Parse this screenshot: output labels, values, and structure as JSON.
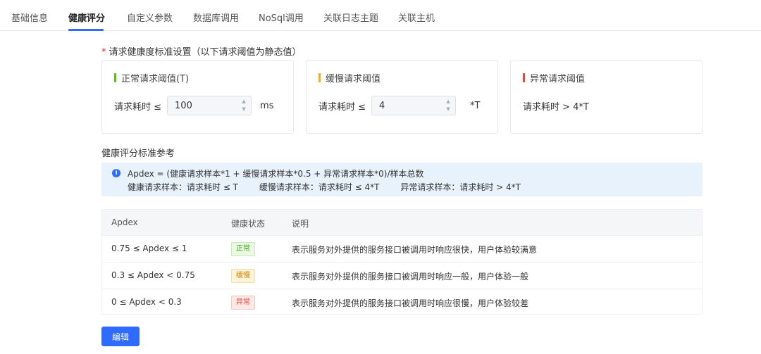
{
  "tabs": [
    {
      "label": "基础信息",
      "active": false
    },
    {
      "label": "健康评分",
      "active": true
    },
    {
      "label": "自定义参数",
      "active": false
    },
    {
      "label": "数据库调用",
      "active": false
    },
    {
      "label": "NoSql调用",
      "active": false
    },
    {
      "label": "关联日志主题",
      "active": false
    },
    {
      "label": "关联主机",
      "active": false
    }
  ],
  "threshold": {
    "required_mark": "*",
    "title": "请求健康度标准设置（以下请求阈值为静态值）",
    "cards": [
      {
        "title": "正常请求阈值(T)",
        "color": "#52c41a",
        "label": "请求耗时 ≤",
        "value": "100",
        "unit": "ms"
      },
      {
        "title": "缓慢请求阈值",
        "color": "#faad14",
        "label": "请求耗时 ≤",
        "value": "4",
        "unit": "*T"
      },
      {
        "title": "异常请求阈值",
        "color": "#e8453c",
        "label": "请求耗时 > 4*T"
      }
    ]
  },
  "reference": {
    "title": "健康评分标准参考",
    "info_icon": "info-icon",
    "formula": "Apdex = (健康请求样本*1 + 缓慢请求样本*0.5 + 异常请求样本*0)/样本总数",
    "definitions": [
      "健康请求样本：请求耗时 ≤ T",
      "缓慢请求样本：请求耗时 ≤ 4*T",
      "异常请求样本：请求耗时 > 4*T"
    ]
  },
  "table": {
    "headers": [
      "Apdex",
      "健康状态",
      "说明"
    ],
    "rows": [
      {
        "apdex": "0.75 ≤ Apdex ≤ 1",
        "status": "正常",
        "desc": "表示服务对外提供的服务接口被调用时响应很快，用户体验较满意"
      },
      {
        "apdex": "0.3 ≤ Apdex < 0.75",
        "status": "缓慢",
        "desc": "表示服务对外提供的服务接口被调用时响应一般，用户体验一般"
      },
      {
        "apdex": "0 ≤ Apdex < 0.3",
        "status": "异常",
        "desc": "表示服务对外提供的服务接口被调用时响应很慢，用户体验较差"
      }
    ]
  },
  "actions": {
    "edit_label": "编辑"
  }
}
